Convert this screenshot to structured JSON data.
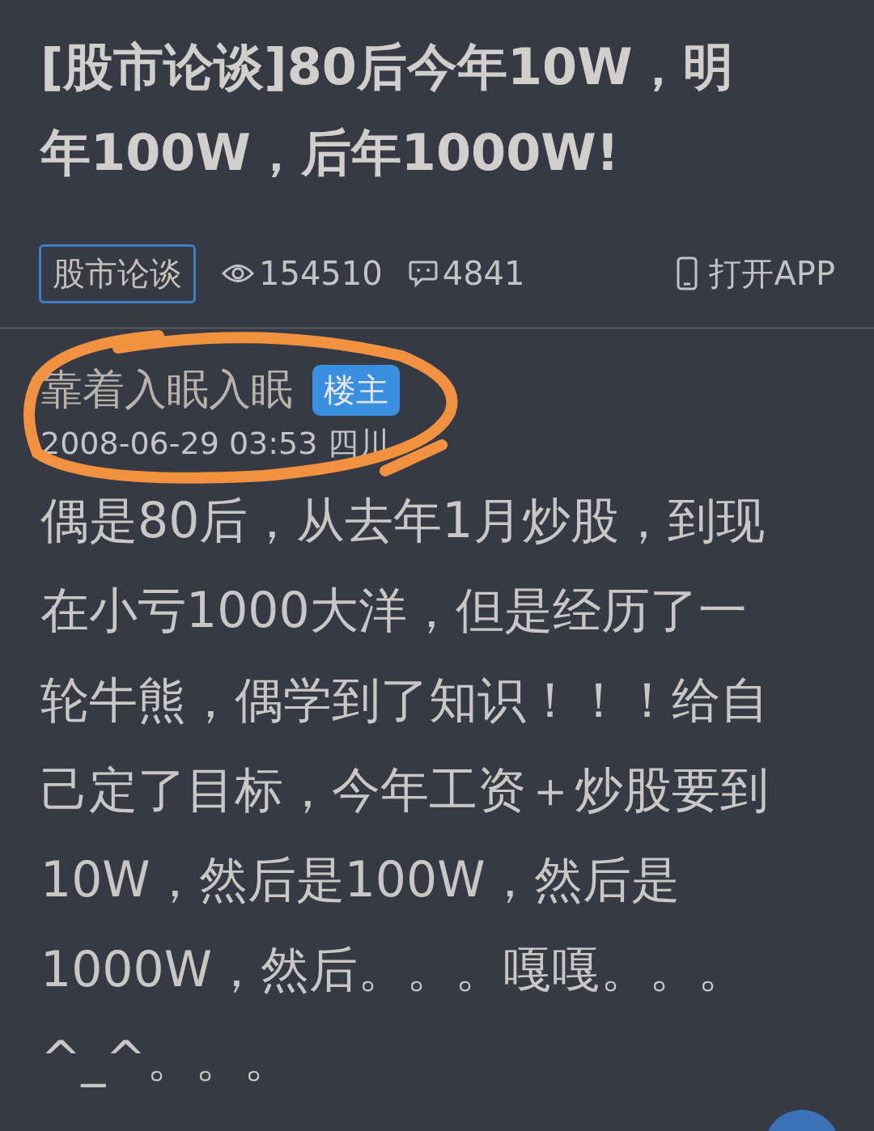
{
  "title": "[股市论谈]80后今年10W，明年100W，后年1000W!",
  "meta": {
    "board": "股市论谈",
    "views": "154510",
    "replies": "4841",
    "open_app": "打开APP"
  },
  "post": {
    "author": "靠着入眠入眠",
    "badge": "楼主",
    "time": "2008-06-29 03:53 四川",
    "body": "偶是80后，从去年1月炒股，到现在小亏1000大洋，但是经历了一轮牛熊，偶学到了知识！！！给自己定了目标，今年工资＋炒股要到10W，然后是100W，然后是1000W，然后。。。嘎嘎。。。^_^。。。"
  }
}
